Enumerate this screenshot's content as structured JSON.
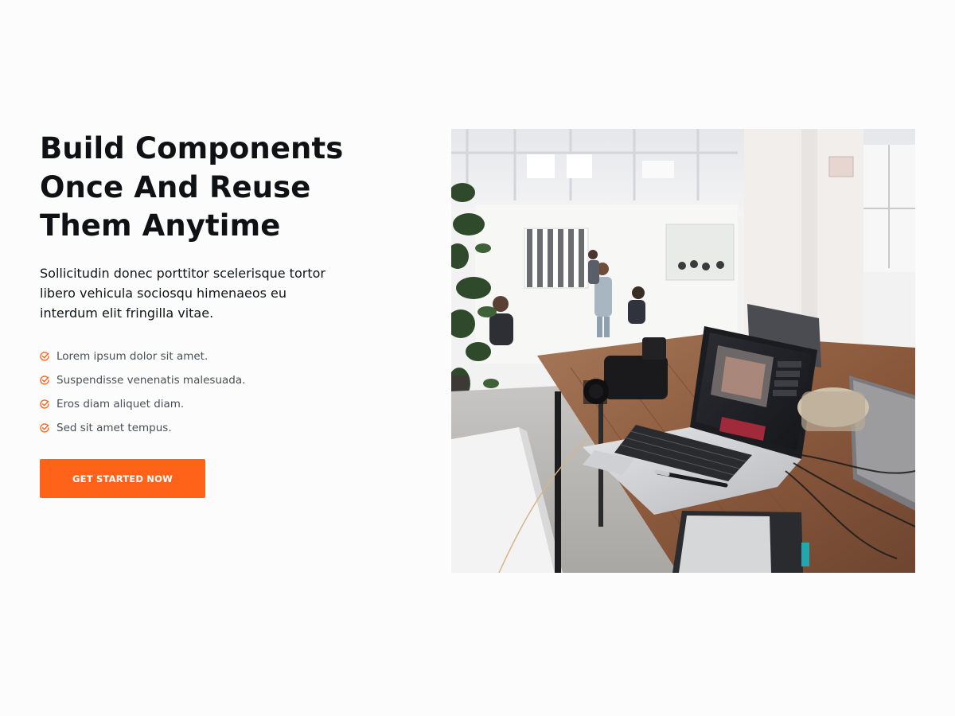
{
  "hero": {
    "title": "Build Components Once And Reuse Them Anytime",
    "lead": "Sollicitudin donec porttitor scelerisque tortor libero vehicula sociosqu himenaeos eu interdum elit fringilla vitae.",
    "features": [
      "Lorem ipsum dolor sit amet.",
      "Suspendisse venenatis malesuada.",
      "Eros diam aliquet diam.",
      "Sed sit amet tempus."
    ],
    "cta_label": "GET STARTED NOW",
    "check_icon": "check-circle-icon"
  },
  "colors": {
    "accent": "#ff6319",
    "heading": "#0f1115",
    "muted_text": "#4a4e55",
    "background": "#fbfcfb"
  }
}
